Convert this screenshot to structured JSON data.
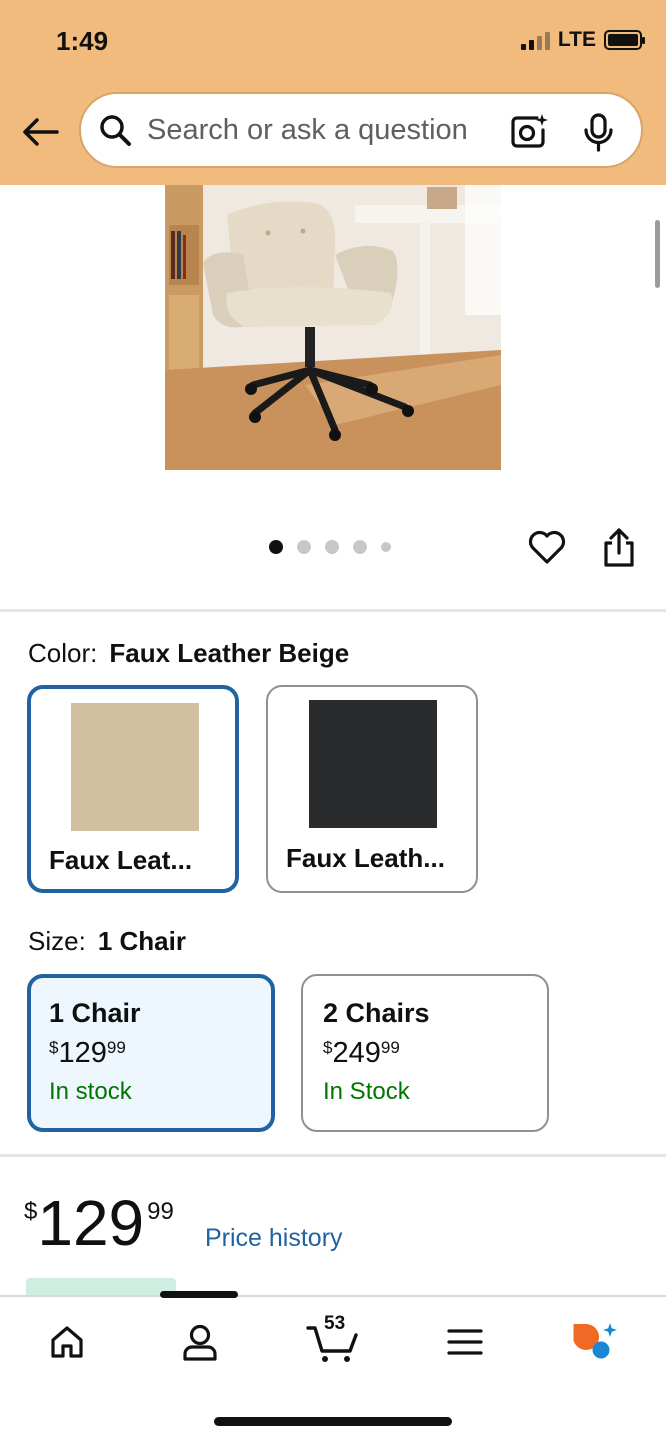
{
  "status_bar": {
    "time": "1:49",
    "network": "LTE"
  },
  "search": {
    "placeholder": "Search or ask a question"
  },
  "image_carousel": {
    "total_images": 5,
    "active_index": 0
  },
  "color": {
    "label": "Color:",
    "selected": "Faux Leather Beige",
    "options": [
      {
        "name": "Faux Leat...",
        "swatch": "#d2bea0",
        "selected": true
      },
      {
        "name": "Faux Leath...",
        "swatch": "#2a2b2d",
        "selected": false
      }
    ]
  },
  "size": {
    "label": "Size:",
    "selected": "1 Chair",
    "options": [
      {
        "title": "1 Chair",
        "currency": "$",
        "whole": "129",
        "fraction": "99",
        "stock": "In stock",
        "selected": true
      },
      {
        "title": "2 Chairs",
        "currency": "$",
        "whole": "249",
        "fraction": "99",
        "stock": "In Stock",
        "selected": false
      }
    ]
  },
  "price": {
    "currency": "$",
    "whole": "129",
    "fraction": "99",
    "history_link": "Price history"
  },
  "bottom_nav": {
    "cart_count": "53"
  },
  "colors": {
    "header_bg": "#f0bb7d",
    "accent_blue": "#2162a1",
    "stock_green": "#007600",
    "selected_card_bg": "#edf7fd"
  }
}
